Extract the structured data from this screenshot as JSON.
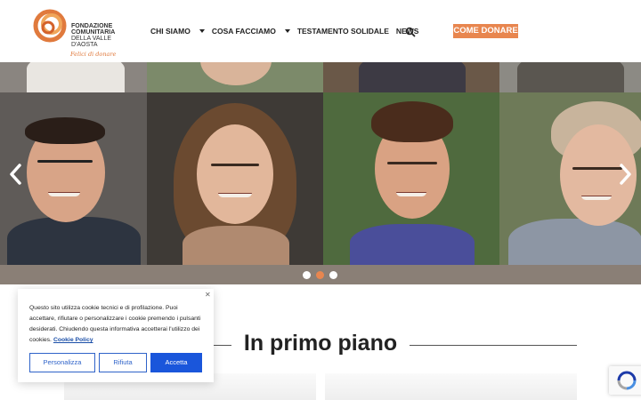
{
  "header": {
    "logo": {
      "name_line1": "FONDAZIONE",
      "name_line2": "COMUNITARIA",
      "name_line3": "DELLA VALLE",
      "name_line4": "D'AOSTA",
      "tagline": "Felici di donare"
    },
    "nav": [
      {
        "label": "CHI SIAMO",
        "has_dropdown": true
      },
      {
        "label": "COSA FACCIAMO",
        "has_dropdown": true
      },
      {
        "label": "TESTAMENTO SOLIDALE",
        "has_dropdown": false
      },
      {
        "label": "NEWS",
        "has_dropdown": false
      }
    ],
    "search_icon": "search-icon",
    "donate_label": "COME DONARE"
  },
  "hero": {
    "slide_count": 3,
    "active_slide": 2,
    "prev_icon": "chevron-left-icon",
    "next_icon": "chevron-right-icon"
  },
  "section": {
    "title": "In primo piano"
  },
  "cookie_banner": {
    "text": "Questo sito utilizza cookie tecnici e di profilazione. Puoi accettare, rifiutare o personalizzare i cookie premendo i pulsanti desiderati. Chiudendo questa informativa accetterai l'utilizzo dei cookies.",
    "policy_link": "Cookie Policy",
    "customize_label": "Personalizza",
    "reject_label": "Rifiuta",
    "accept_label": "Accetta",
    "close_icon": "close-icon"
  },
  "colors": {
    "accent": "#e8864f",
    "cookie_blue": "#1a56db"
  }
}
